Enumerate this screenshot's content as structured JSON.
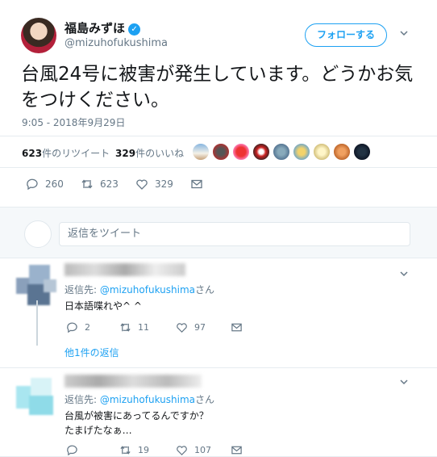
{
  "tweet": {
    "display_name": "福島みずほ",
    "handle": "@mizuhofukushima",
    "follow_label": "フォローする",
    "text": "台風24号に被害が発生しています。どうかお気をつけください。",
    "timestamp": "9:05 - 2018年9月29日",
    "retweets_count": "623",
    "retweets_label": "件のリツイート",
    "likes_count": "329",
    "likes_label": "件のいいね",
    "reply_count": "260",
    "retweet_count": "623",
    "like_count": "329"
  },
  "reply_box": {
    "placeholder": "返信をツイート"
  },
  "replies": [
    {
      "reply_to_prefix": "返信先: ",
      "reply_to_handle": "@mizuhofukushima",
      "reply_to_suffix": "さん",
      "text_lines": [
        "日本語喋れや^ ^"
      ],
      "reply_count": "2",
      "retweet_count": "11",
      "like_count": "97",
      "more_replies": "他1件の返信"
    },
    {
      "reply_to_prefix": "返信先: ",
      "reply_to_handle": "@mizuhofukushima",
      "reply_to_suffix": "さん",
      "text_lines": [
        "台風が被害にあってるんですか？",
        "たまげたなぁ…"
      ],
      "retweet_count": "19",
      "like_count": "107"
    }
  ],
  "colors": {
    "accent": "#1da1f2",
    "muted": "#657786",
    "border": "#e6ecf0"
  }
}
